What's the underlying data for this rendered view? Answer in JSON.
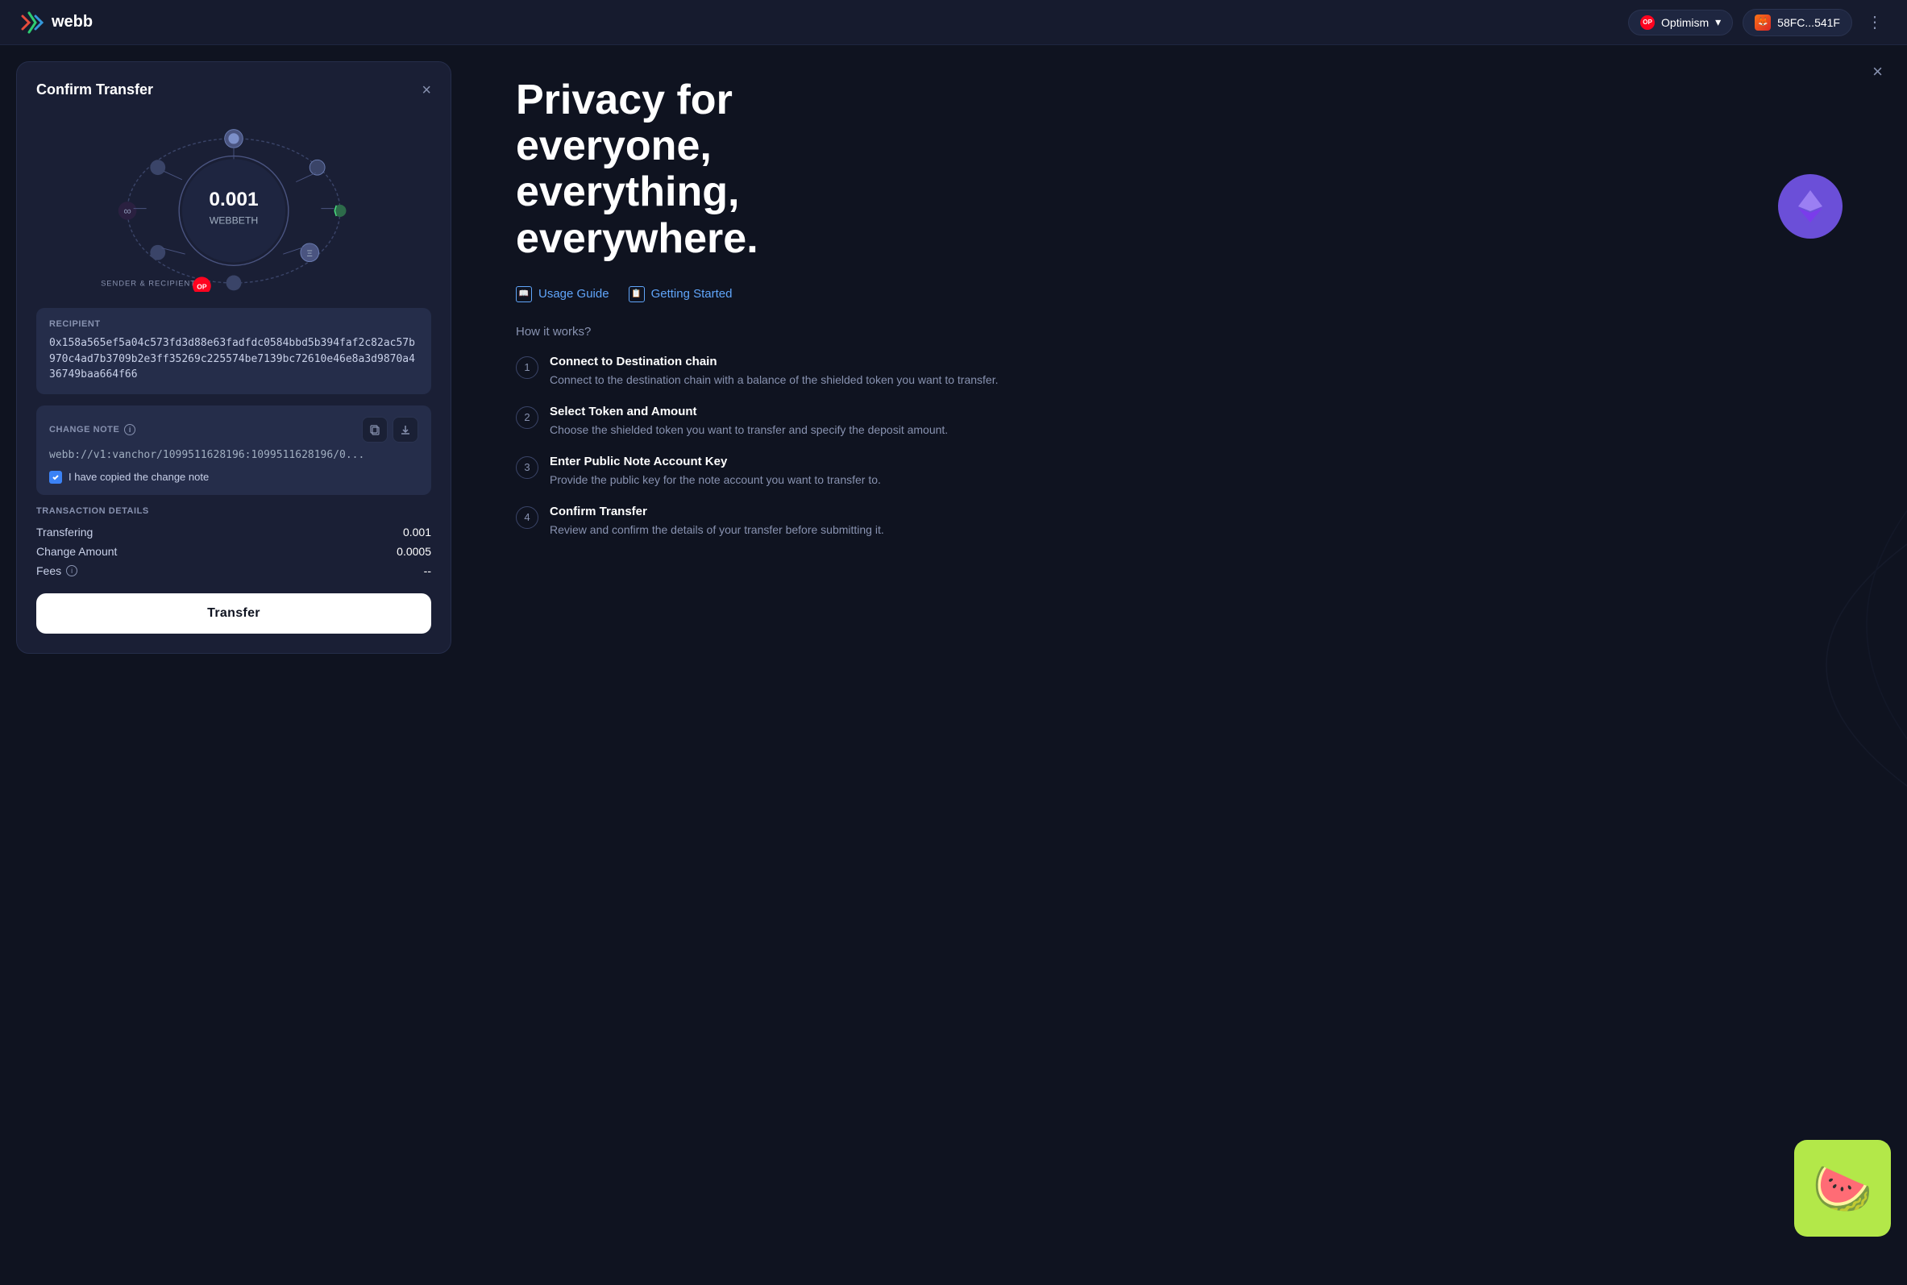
{
  "header": {
    "logo_text": "webb",
    "network_label": "Optimism",
    "network_short": "OP",
    "wallet_label": "58FC...541F",
    "more_label": "⋮"
  },
  "modal": {
    "title": "Confirm Transfer",
    "close": "×",
    "network_viz": {
      "amount": "0.001",
      "token": "WEBBETH",
      "sender_label": "SENDER & RECIPIENT"
    },
    "recipient": {
      "label": "RECIPIENT",
      "value": "0x158a565ef5a04c573fd3d88e63fadfdc0584bbd5b394faf2c82ac57b970c4ad7b3709b2e3ff35269c225574be7139bc72610e46e8a3d9870a436749baa664f66"
    },
    "change_note": {
      "label": "CHANGE NOTE",
      "value": "webb://v1:vanchor/1099511628196:1099511628196/0...",
      "copy_btn": "copy",
      "download_btn": "download",
      "checkbox_label": "I have copied the change note",
      "checked": true
    },
    "tx_details": {
      "title": "TRANSACTION DETAILS",
      "rows": [
        {
          "label": "Transfering",
          "value": "0.001"
        },
        {
          "label": "Change Amount",
          "value": "0.0005"
        },
        {
          "label": "Fees",
          "value": "--"
        }
      ]
    },
    "transfer_btn": "Transfer"
  },
  "right_panel": {
    "title": "Privacy for everyone, everything, everywhere.",
    "close": "×",
    "links": [
      {
        "label": "Usage Guide"
      },
      {
        "label": "Getting Started"
      }
    ],
    "how_it_works": "How it works?",
    "steps": [
      {
        "num": "1",
        "title": "Connect to Destination chain",
        "desc": "Connect to the destination chain with a balance of the shielded token you want to transfer."
      },
      {
        "num": "2",
        "title": "Select Token and Amount",
        "desc": "Choose the shielded token you want to transfer and specify the deposit amount."
      },
      {
        "num": "3",
        "title": "Enter Public Note Account Key",
        "desc": "Provide the public key for the note account you want to transfer to."
      },
      {
        "num": "4",
        "title": "Confirm Transfer",
        "desc": "Review and confirm the details of your transfer before submitting it."
      }
    ]
  }
}
